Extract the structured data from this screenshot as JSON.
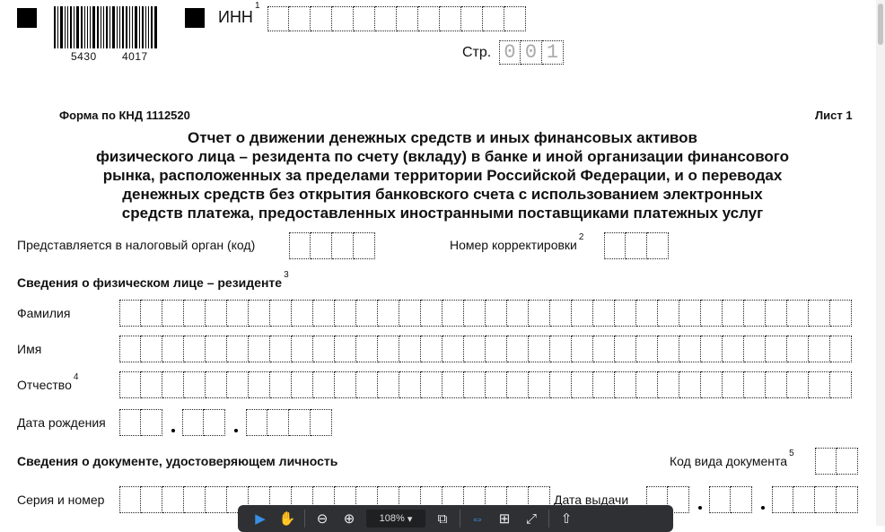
{
  "header": {
    "barcode_left": "5430",
    "barcode_right": "4017",
    "inn_label": "ИНН",
    "inn_note": "1",
    "page_label": "Стр.",
    "page_digits": [
      "0",
      "0",
      "1"
    ]
  },
  "form": {
    "form_code": "Форма по КНД 1112520",
    "sheet": "Лист 1",
    "title_lines": [
      "Отчет о движении денежных средств и иных финансовых активов",
      "физического лица – резидента по счету (вкладу) в банке и иной организации финансового",
      "рынка, расположенных за пределами территории Российской Федерации, и о переводах",
      "денежных средств без открытия банковского счета с использованием электронных",
      "средств платежа, предоставленных иностранными поставщиками платежных услуг"
    ]
  },
  "fields": {
    "tax_authority_label": "Представляется в налоговый орган (код)",
    "correction_label": "Номер корректировки",
    "correction_note": "2",
    "person_section": "Сведения о физическом лице – резиденте",
    "person_note": "3",
    "surname_label": "Фамилия",
    "name_label": "Имя",
    "patronymic_label": "Отчество",
    "patronymic_note": "4",
    "birthdate_label": "Дата рождения",
    "document_section": "Сведения о документе, удостоверяющем личность",
    "doc_type_label": "Код вида документа",
    "doc_type_note": "5",
    "series_label": "Серия и номер",
    "issue_date_label": "Дата выдачи"
  },
  "toolbar": {
    "zoom": "108%",
    "icons": [
      "cursor-icon",
      "hand-icon",
      "zoom-out-icon",
      "zoom-in-icon",
      "copy-icon",
      "fit-width-icon",
      "add-page-icon",
      "fullscreen-icon",
      "upload-icon"
    ]
  }
}
